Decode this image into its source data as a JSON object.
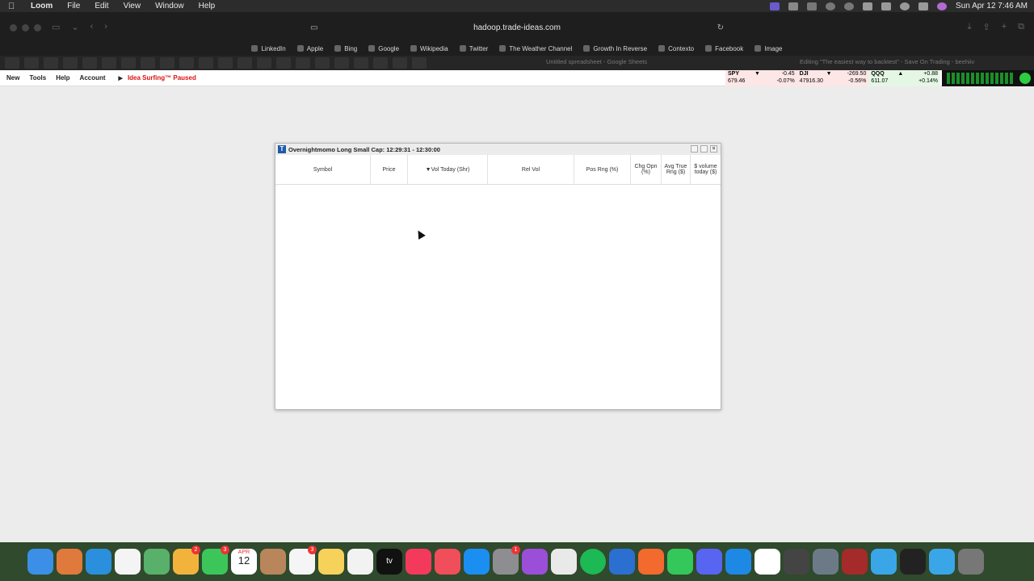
{
  "menubar": {
    "app": "Loom",
    "items": [
      "File",
      "Edit",
      "View",
      "Window",
      "Help"
    ],
    "clock": "Sun Apr 12  7:46 AM"
  },
  "browser": {
    "url": "hadoop.trade-ideas.com",
    "bookmarks": [
      "LinkedIn",
      "Apple",
      "Bing",
      "Google",
      "Wikipedia",
      "Twitter",
      "The Weather Channel",
      "Growth In Reverse",
      "Contexto",
      "Facebook",
      "Image"
    ],
    "tab_sheet": "Untitled spreadsheet - Google Sheets",
    "tab_editing": "Editing \"The easiest way to backtest\" - Save On Trading - beehiiv"
  },
  "appbar": {
    "items": [
      "New",
      "Tools",
      "Help",
      "Account"
    ],
    "status": "Idea Surfing™ Paused"
  },
  "ticker": [
    {
      "sym": "SPY",
      "price": "679.46",
      "chg": "-0.45",
      "pct": "-0.07%",
      "dir": "▼"
    },
    {
      "sym": "DJI",
      "price": "47916.30",
      "chg": "-269.50",
      "pct": "-0.56%",
      "dir": "▼"
    },
    {
      "sym": "QQQ",
      "price": "611.07",
      "chg": "+0.88",
      "pct": "+0.14%",
      "dir": "▲"
    }
  ],
  "window": {
    "title": "Overnightmomo Long Small Cap: 12:29:31 - 12:30:00",
    "columns": [
      "Symbol",
      "Price",
      "▼Vol Today (Shr)",
      "Rel Vol",
      "Pos Rng (%)",
      "Chg Opn (%)",
      "Avg True Rng ($)",
      "$ volume today ($)"
    ]
  },
  "dock": {
    "badges": [
      "2",
      "3",
      "3",
      "1"
    ],
    "date_month": "APR",
    "date_day": "12",
    "tv_label": "tv"
  }
}
